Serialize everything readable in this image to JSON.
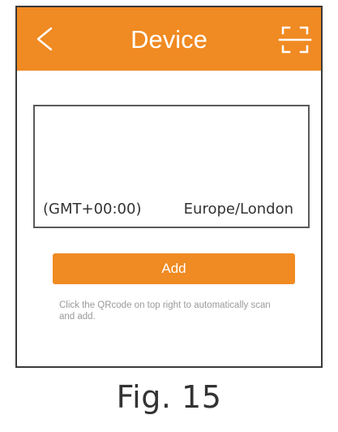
{
  "header": {
    "title": "Device",
    "back_icon": "chevron-left-icon",
    "scan_icon": "qr-scan-icon",
    "background_color": "#F08A22"
  },
  "timezone": {
    "offset": "(GMT+00:00)",
    "name": "Europe/London"
  },
  "add_button": {
    "label": "Add",
    "color": "#F08A22"
  },
  "hint": "Click the QRcode on top right to automatically scan and add.",
  "caption": "Fig. 15"
}
